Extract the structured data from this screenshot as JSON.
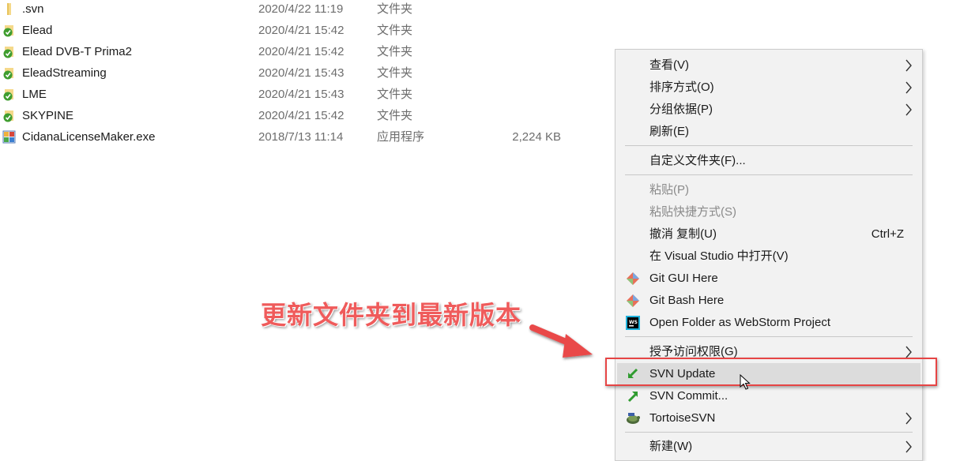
{
  "files": [
    {
      "icon": "folder-icon",
      "name": ".svn",
      "date": "2020/4/22 11:19",
      "type": "文件夹",
      "size": ""
    },
    {
      "icon": "svn-folder-normal-icon",
      "name": "Elead",
      "date": "2020/4/21 15:42",
      "type": "文件夹",
      "size": ""
    },
    {
      "icon": "svn-folder-normal-icon",
      "name": "Elead DVB-T Prima2",
      "date": "2020/4/21 15:42",
      "type": "文件夹",
      "size": ""
    },
    {
      "icon": "svn-folder-normal-icon",
      "name": "EleadStreaming",
      "date": "2020/4/21 15:43",
      "type": "文件夹",
      "size": ""
    },
    {
      "icon": "svn-folder-normal-icon",
      "name": "LME",
      "date": "2020/4/21 15:43",
      "type": "文件夹",
      "size": ""
    },
    {
      "icon": "svn-folder-normal-icon",
      "name": "SKYPINE",
      "date": "2020/4/21 15:42",
      "type": "文件夹",
      "size": ""
    },
    {
      "icon": "exe-app-icon",
      "name": "CidanaLicenseMaker.exe",
      "date": "2018/7/13 11:14",
      "type": "应用程序",
      "size": "2,224 KB"
    }
  ],
  "context_menu": {
    "items": [
      {
        "label": "查看(V)",
        "submenu": true
      },
      {
        "label": "排序方式(O)",
        "submenu": true
      },
      {
        "label": "分组依据(P)",
        "submenu": true
      },
      {
        "label": "刷新(E)"
      },
      {
        "label": "自定义文件夹(F)..."
      },
      {
        "label": "粘贴(P)",
        "disabled": true
      },
      {
        "label": "粘贴快捷方式(S)",
        "disabled": true
      },
      {
        "label": "撤消 复制(U)",
        "shortcut": "Ctrl+Z"
      },
      {
        "label": "在 Visual Studio 中打开(V)"
      },
      {
        "label": "Git GUI Here",
        "icon": "git-gui-icon"
      },
      {
        "label": "Git Bash Here",
        "icon": "git-bash-icon"
      },
      {
        "label": "Open Folder as WebStorm Project",
        "icon": "webstorm-icon"
      },
      {
        "label": "授予访问权限(G)",
        "submenu": true
      },
      {
        "label": "SVN Update",
        "icon": "svn-update-icon",
        "highlighted": true
      },
      {
        "label": "SVN Commit...",
        "icon": "svn-commit-icon"
      },
      {
        "label": "TortoiseSVN",
        "icon": "tortoisesvn-icon",
        "submenu": true
      },
      {
        "label": "新建(W)",
        "submenu": true
      }
    ]
  },
  "annotation": {
    "text": "更新文件夹到最新版本",
    "color": "#ef5b5b",
    "box_color": "#e64545"
  },
  "colors": {
    "menu_background": "#f2f2f2",
    "menu_highlight": "#dcdcdc",
    "secondary_text": "#6d6d6d",
    "disabled_text": "#8a8a8a"
  }
}
